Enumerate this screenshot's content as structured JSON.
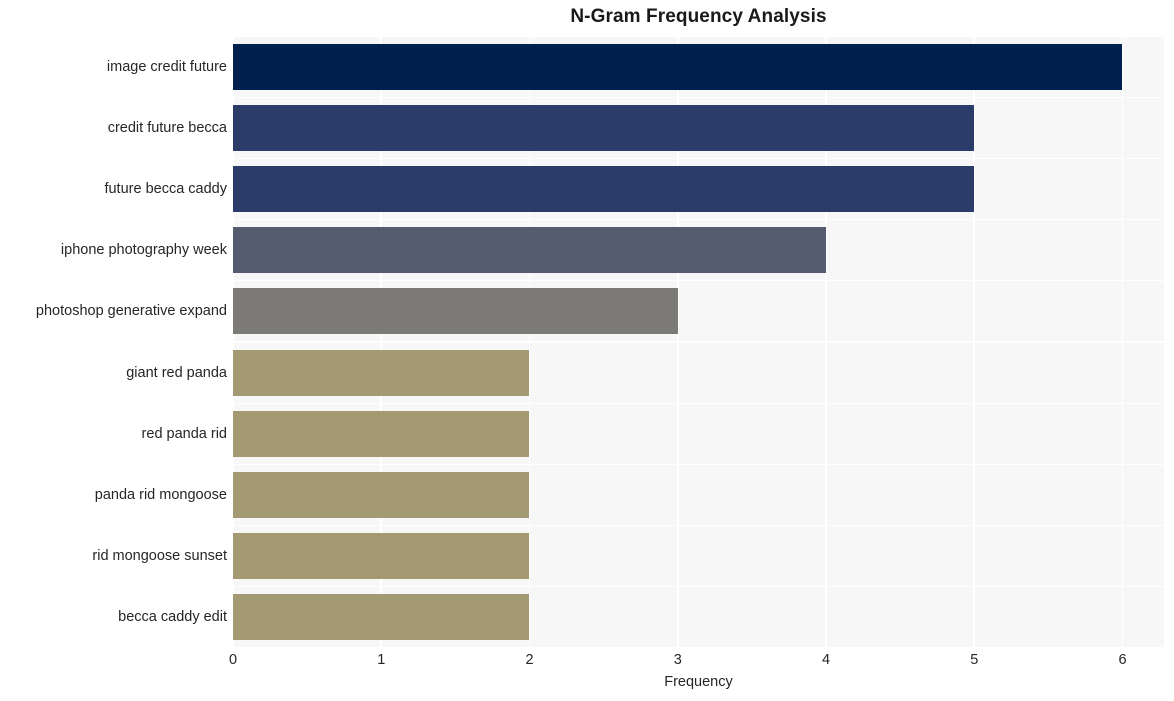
{
  "chart_data": {
    "type": "bar",
    "orientation": "horizontal",
    "title": "N-Gram Frequency Analysis",
    "xlabel": "Frequency",
    "ylabel": "",
    "xlim": [
      0,
      6.28
    ],
    "xticks": [
      "0",
      "1",
      "2",
      "3",
      "4",
      "5",
      "6"
    ],
    "xtick_values": [
      0,
      1,
      2,
      3,
      4,
      5,
      6
    ],
    "grid": true,
    "grid_color": "#ffffff",
    "plot_background": "#f7f7f7",
    "figure_background": "#ffffff",
    "categories": [
      "image credit future",
      "credit future becca",
      "future becca caddy",
      "iphone photography week",
      "photoshop generative expand",
      "giant red panda",
      "red panda rid",
      "panda rid mongoose",
      "rid mongoose sunset",
      "becca caddy edit"
    ],
    "values": [
      6,
      5,
      5,
      4,
      3,
      2,
      2,
      2,
      2,
      2
    ],
    "bar_colors": [
      "#00214e",
      "#2b3c6a",
      "#2b3c6a",
      "#555c70",
      "#7b7a77",
      "#a39a73",
      "#a39a73",
      "#a39a73",
      "#a39a73",
      "#a39a73"
    ]
  }
}
